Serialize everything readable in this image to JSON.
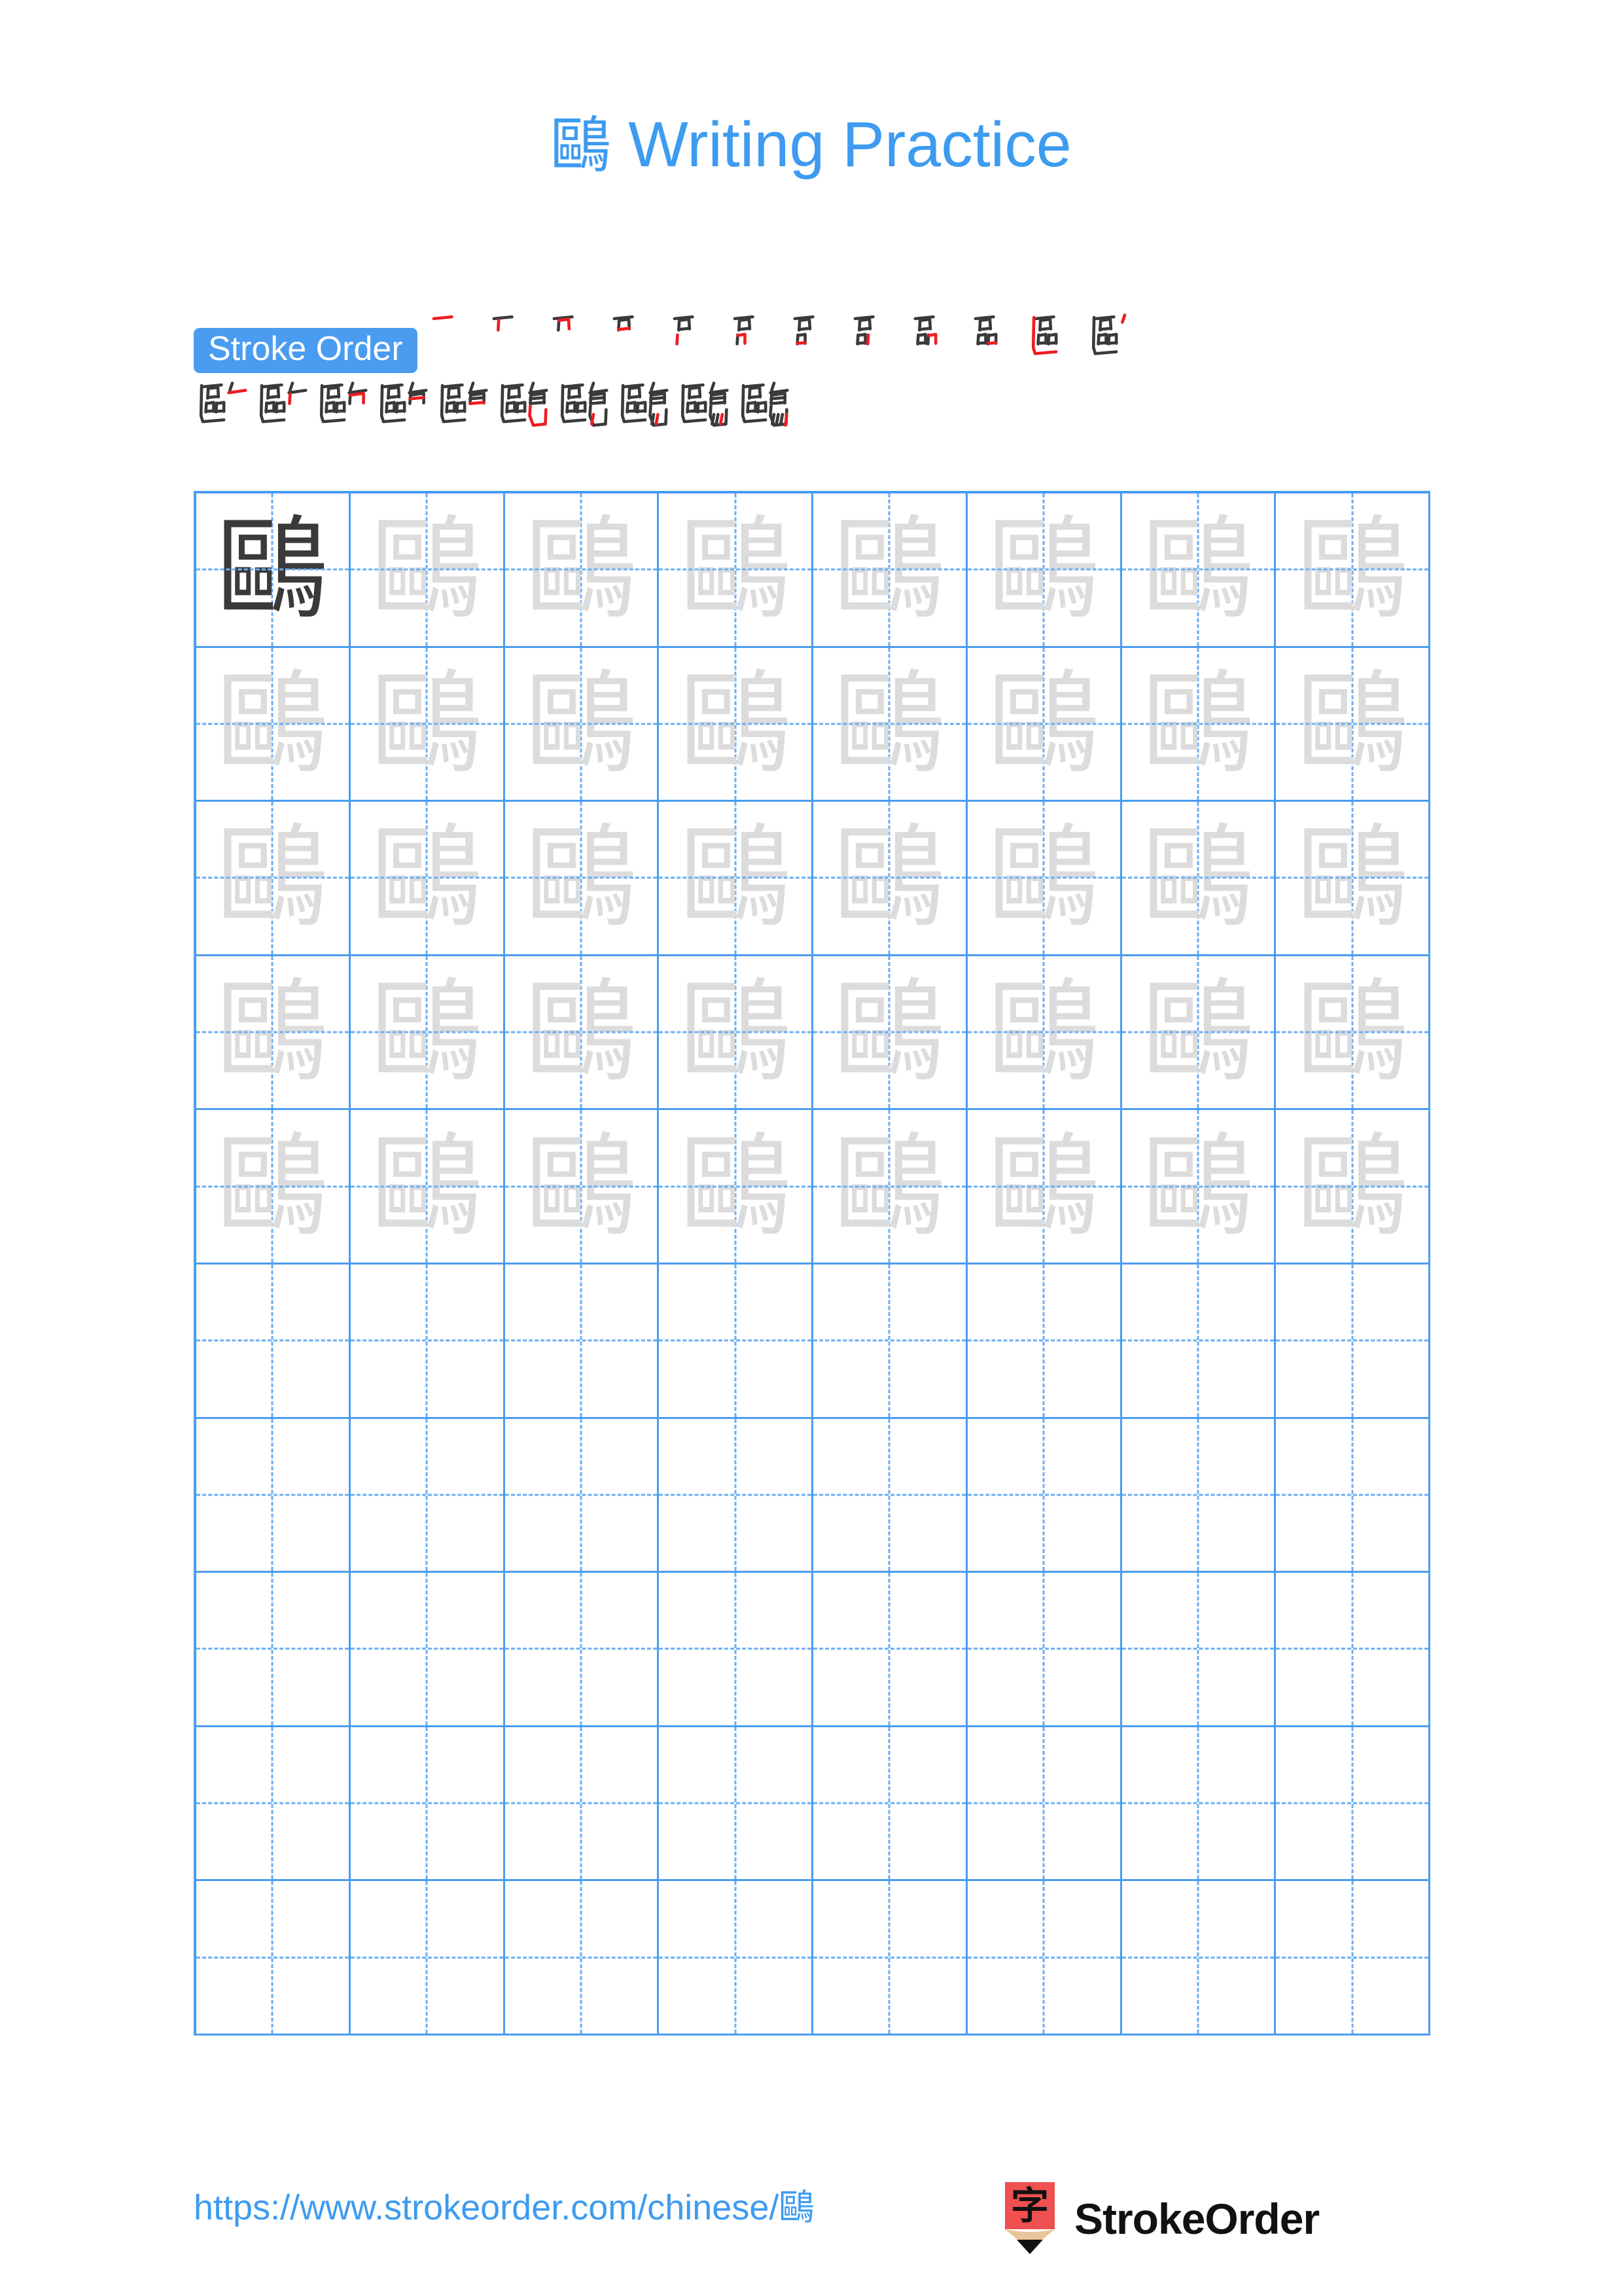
{
  "page": {
    "character": "鷗",
    "title_suffix": " Writing Practice",
    "background_color": "#ffffff",
    "accent_color": "#3d9bf0",
    "grid_line_color": "#4a9cf0",
    "guide_line_color": "#6aaef3",
    "traced_char_color": "#dcdcdc",
    "model_char_color": "#3a3a3a",
    "stroke_new_color": "#ee1c24",
    "stroke_prev_color": "#3a3a3a"
  },
  "header": {
    "title_character": "鷗",
    "title_text": "Writing Practice"
  },
  "stroke_order": {
    "badge_label": "Stroke Order",
    "total_strokes": 22,
    "row1_count": 12,
    "row2_count": 10,
    "steps": [
      {
        "index": 1,
        "new_stroke_color": "#ee1c24"
      },
      {
        "index": 2,
        "new_stroke_color": "#ee1c24"
      },
      {
        "index": 3,
        "new_stroke_color": "#ee1c24"
      },
      {
        "index": 4,
        "new_stroke_color": "#ee1c24"
      },
      {
        "index": 5,
        "new_stroke_color": "#ee1c24"
      },
      {
        "index": 6,
        "new_stroke_color": "#ee1c24"
      },
      {
        "index": 7,
        "new_stroke_color": "#ee1c24"
      },
      {
        "index": 8,
        "new_stroke_color": "#ee1c24"
      },
      {
        "index": 9,
        "new_stroke_color": "#ee1c24"
      },
      {
        "index": 10,
        "new_stroke_color": "#ee1c24"
      },
      {
        "index": 11,
        "new_stroke_color": "#ee1c24"
      },
      {
        "index": 12,
        "new_stroke_color": "#ee1c24"
      },
      {
        "index": 13,
        "new_stroke_color": "#ee1c24"
      },
      {
        "index": 14,
        "new_stroke_color": "#ee1c24"
      },
      {
        "index": 15,
        "new_stroke_color": "#ee1c24"
      },
      {
        "index": 16,
        "new_stroke_color": "#ee1c24"
      },
      {
        "index": 17,
        "new_stroke_color": "#ee1c24"
      },
      {
        "index": 18,
        "new_stroke_color": "#ee1c24"
      },
      {
        "index": 19,
        "new_stroke_color": "#ee1c24"
      },
      {
        "index": 20,
        "new_stroke_color": "#ee1c24"
      },
      {
        "index": 21,
        "new_stroke_color": "#ee1c24"
      },
      {
        "index": 22,
        "new_stroke_color": "#ee1c24"
      }
    ]
  },
  "practice_grid": {
    "columns": 8,
    "rows": 10,
    "cells_total": 80,
    "model_cell_index": 0,
    "traced_cell_count": 39,
    "empty_cell_count": 40,
    "rows_with_characters": 5,
    "rows_empty": 5
  },
  "footer": {
    "url": "https://www.strokeorder.com/chinese/鷗",
    "brand_name": "StrokeOrder",
    "logo_icon": "pencil-icon",
    "logo_character": "字",
    "logo_body_color": "#f05050",
    "logo_wood_color": "#e8c49a",
    "logo_tip_color": "#111111"
  }
}
